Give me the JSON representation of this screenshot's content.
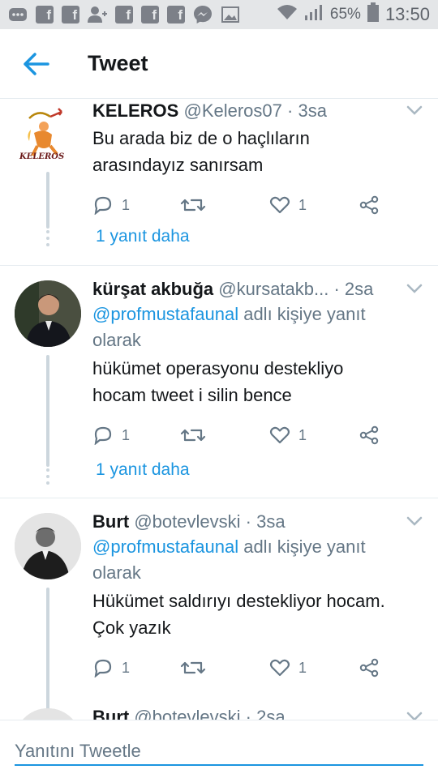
{
  "status_bar": {
    "notification_icons": [
      "chat-icon",
      "facebook-icon",
      "facebook-icon",
      "add-user-icon",
      "facebook-icon",
      "facebook-icon",
      "facebook-icon",
      "messenger-icon",
      "image-icon"
    ],
    "battery_percent": "65%",
    "time": "13:50"
  },
  "header": {
    "title": "Tweet"
  },
  "tweets": [
    {
      "name": "KELEROS",
      "handle": "@Keleros07",
      "time": "· 3sa",
      "reply_prefix": "",
      "reply_mention": "",
      "reply_suffix": "",
      "reply_suffix2": "",
      "text_lines": [
        "Bu arada biz de o haçlıların",
        "arasındayız sanırsam"
      ],
      "reply_count": "1",
      "retweet_count": "",
      "like_count": "1",
      "more_replies": "1 yanıt daha",
      "avatar_text": "KELEROS"
    },
    {
      "name": "kürşat akbuğa",
      "handle": "@kursatakb...",
      "time": "· 2sa",
      "reply_mention": "@profmustafaunal",
      "reply_suffix": " adlı kişiye yanıt",
      "reply_suffix2": "olarak",
      "text_lines": [
        "hükümet operasyonu destekliyo",
        "hocam tweet i silin bence"
      ],
      "reply_count": "1",
      "retweet_count": "",
      "like_count": "1",
      "more_replies": "1 yanıt daha"
    },
    {
      "name": "Burt",
      "handle": "@botevlevski",
      "time": "· 3sa",
      "reply_mention": "@profmustafaunal",
      "reply_suffix": " adlı kişiye yanıt",
      "reply_suffix2": "olarak",
      "text_lines": [
        "Hükümet saldırıyı destekliyor hocam.",
        "Çok yazık"
      ],
      "reply_count": "1",
      "retweet_count": "",
      "like_count": "1"
    },
    {
      "name": "Burt",
      "handle": "@botevlevski",
      "time": "· 2sa"
    }
  ],
  "compose": {
    "placeholder": "Yanıtını Tweetle"
  },
  "colors": {
    "accent": "#1b95e0",
    "secondary_text": "#657786",
    "thread_line": "#ccd6dd"
  }
}
